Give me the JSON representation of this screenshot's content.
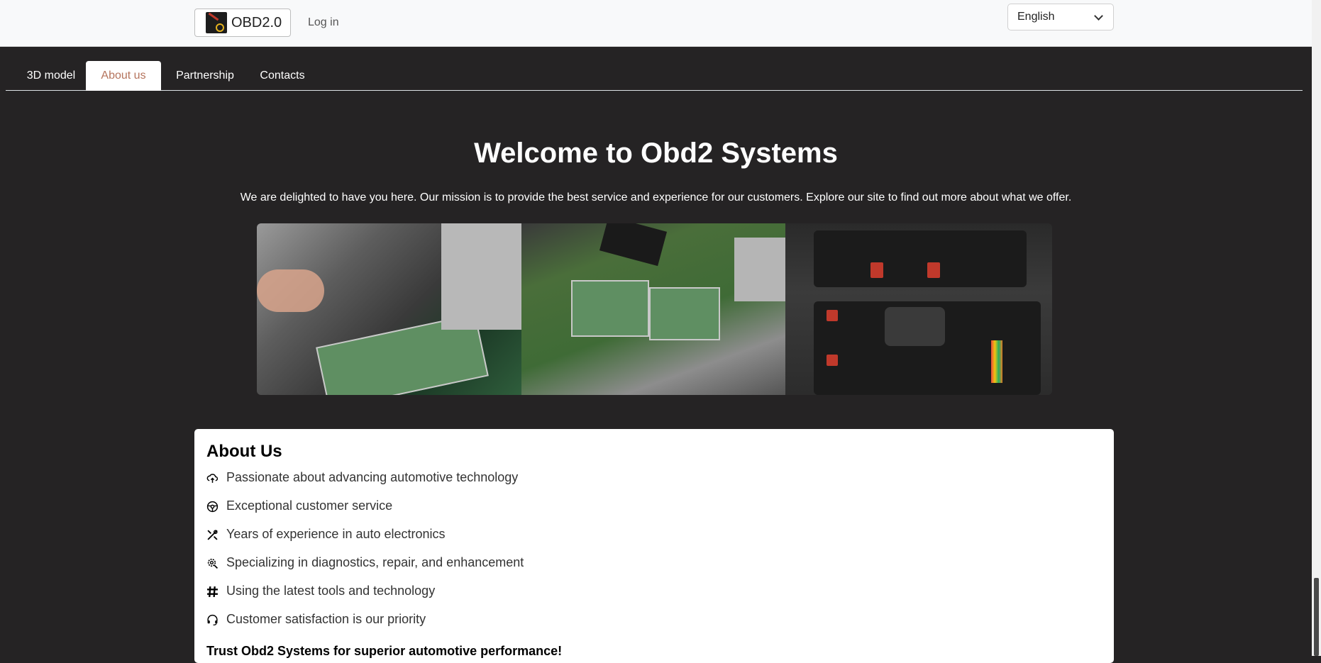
{
  "header": {
    "brand_label": "OBD2.0",
    "login_label": "Log in",
    "language": "English"
  },
  "tabs": [
    {
      "label": "3D model",
      "active": false
    },
    {
      "label": "About us",
      "active": true
    },
    {
      "label": "Partnership",
      "active": false
    },
    {
      "label": "Contacts",
      "active": false
    }
  ],
  "hero": {
    "title": "Welcome to Obd2 Systems",
    "text": "We are delighted to have you here. Our mission is to provide the best service and experience for our customers. Explore our site to find out more about what we offer."
  },
  "about": {
    "title": "About Us",
    "items": [
      {
        "icon": "cloud-upload-icon",
        "label": "Passionate about advancing automotive technology"
      },
      {
        "icon": "steering-wheel-icon",
        "label": "Exceptional customer service"
      },
      {
        "icon": "tools-icon",
        "label": "Years of experience in auto electronics"
      },
      {
        "icon": "gear-search-icon",
        "label": "Specializing in diagnostics, repair, and enhancement"
      },
      {
        "icon": "hashtag-icon",
        "label": "Using the latest tools and technology"
      },
      {
        "icon": "headset-icon",
        "label": "Customer satisfaction is our priority"
      }
    ],
    "footer": "Trust Obd2 Systems for superior automotive performance!"
  },
  "colors": {
    "page_bg": "#252324",
    "active_tab_text": "#b5745d",
    "topbar_bg": "#f8f9fa"
  }
}
